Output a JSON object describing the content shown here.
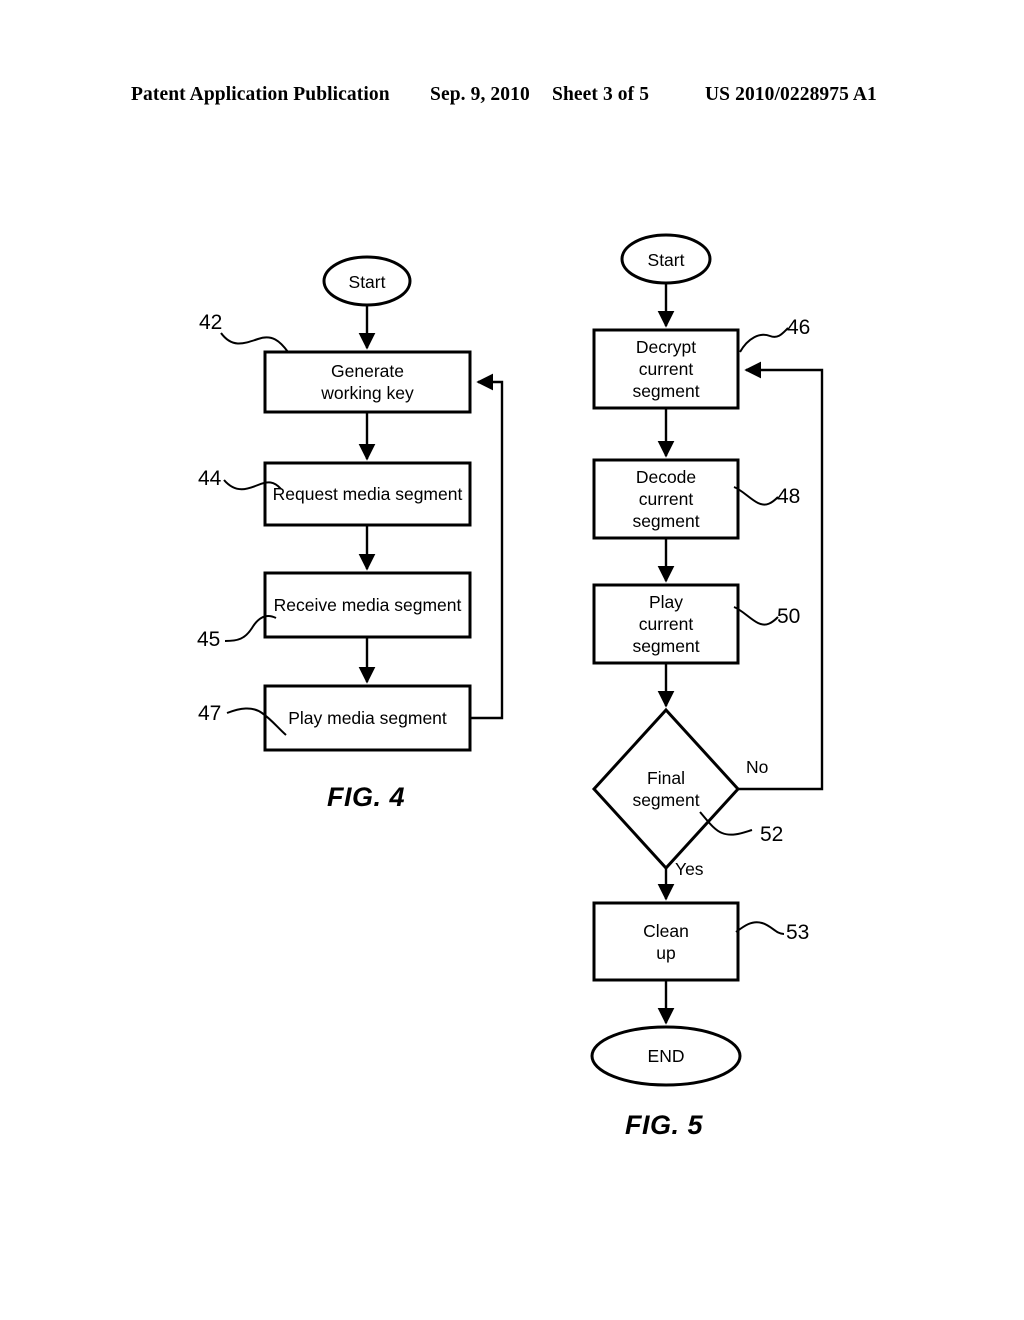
{
  "header": {
    "publication": "Patent Application Publication",
    "date": "Sep. 9, 2010",
    "sheet": "Sheet 3 of 5",
    "patent_number": "US 2010/0228975 A1"
  },
  "figures": [
    {
      "caption": "FIG. 4",
      "nodes": [
        {
          "id": "start4",
          "type": "terminator",
          "label": "Start"
        },
        {
          "id": "gen_key",
          "type": "process",
          "label": "Generate\nworking key",
          "line1": "Generate",
          "line2": "working key",
          "ref": "42"
        },
        {
          "id": "req_seg",
          "type": "process",
          "label": "Request media segment",
          "line1": "Request media segment",
          "line2": "",
          "ref": "44"
        },
        {
          "id": "recv_seg",
          "type": "process",
          "label": "Receive media segment",
          "line1": "Receive media segment",
          "line2": "",
          "ref": "45"
        },
        {
          "id": "play_seg",
          "type": "process",
          "label": "Play media segment",
          "line1": "Play media segment",
          "line2": "",
          "ref": "47"
        }
      ],
      "edges": [
        {
          "from": "start4",
          "to": "gen_key",
          "label": ""
        },
        {
          "from": "gen_key",
          "to": "req_seg",
          "label": ""
        },
        {
          "from": "req_seg",
          "to": "recv_seg",
          "label": ""
        },
        {
          "from": "recv_seg",
          "to": "play_seg",
          "label": ""
        },
        {
          "from": "play_seg",
          "to": "gen_key",
          "label": "",
          "kind": "feedback-loop"
        }
      ]
    },
    {
      "caption": "FIG. 5",
      "nodes": [
        {
          "id": "start5",
          "type": "terminator",
          "label": "Start"
        },
        {
          "id": "decrypt",
          "type": "process",
          "line1": "Decrypt",
          "line2": "current",
          "line3": "segment",
          "ref": "46"
        },
        {
          "id": "decode",
          "type": "process",
          "line1": "Decode",
          "line2": "current",
          "line3": "segment",
          "ref": "48"
        },
        {
          "id": "play_cur",
          "type": "process",
          "line1": "Play",
          "line2": "current",
          "line3": "segment",
          "ref": "50"
        },
        {
          "id": "final_seg",
          "type": "decision",
          "line1": "Final",
          "line2": "segment",
          "ref": "52"
        },
        {
          "id": "clean_up",
          "type": "process",
          "line1": "Clean",
          "line2": "up",
          "ref": "53"
        },
        {
          "id": "end5",
          "type": "terminator",
          "label": "END"
        }
      ],
      "edges": [
        {
          "from": "start5",
          "to": "decrypt",
          "label": ""
        },
        {
          "from": "decrypt",
          "to": "decode",
          "label": ""
        },
        {
          "from": "decode",
          "to": "play_cur",
          "label": ""
        },
        {
          "from": "play_cur",
          "to": "final_seg",
          "label": ""
        },
        {
          "from": "final_seg",
          "to": "clean_up",
          "label": "Yes"
        },
        {
          "from": "final_seg",
          "to": "decrypt",
          "label": "No",
          "kind": "feedback-loop"
        },
        {
          "from": "clean_up",
          "to": "end5",
          "label": ""
        }
      ]
    }
  ],
  "colors": {
    "ink": "#000000",
    "paper": "#ffffff"
  }
}
